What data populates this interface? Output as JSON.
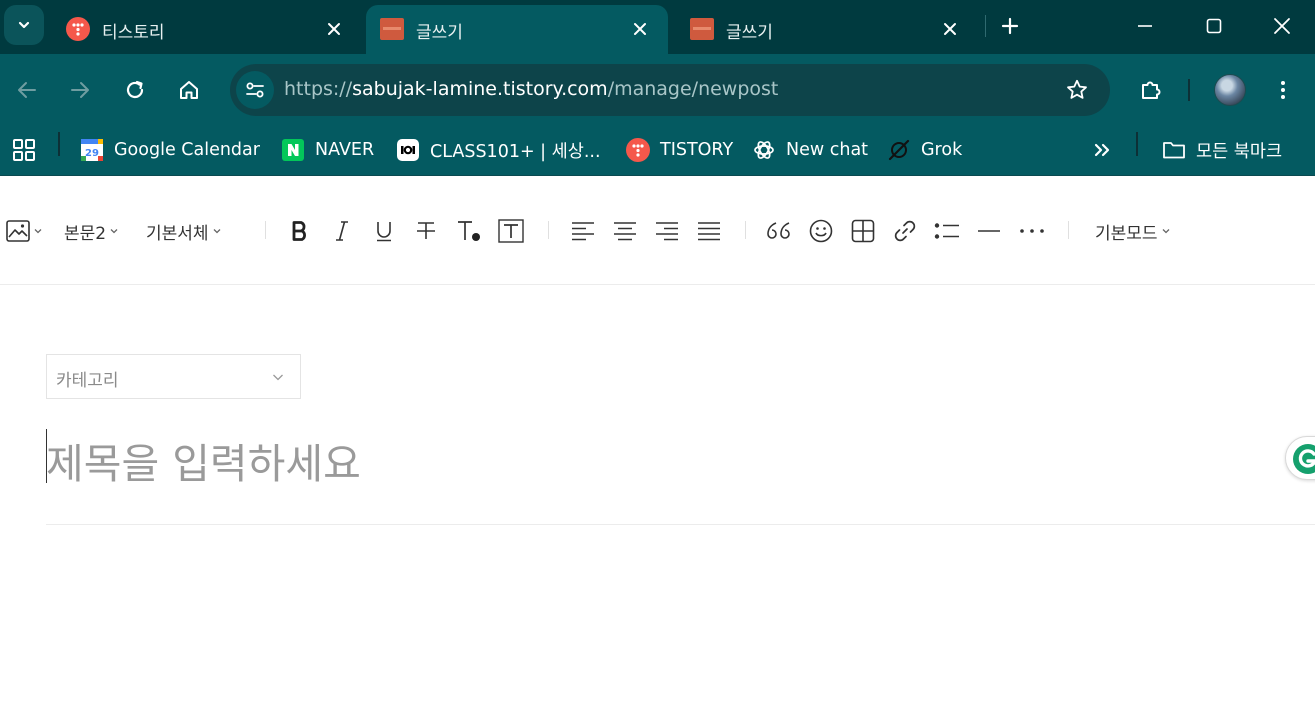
{
  "browser": {
    "tabs": [
      {
        "title": "티스토리",
        "favicon": "tistory-icon",
        "active": false
      },
      {
        "title": "글쓰기",
        "favicon": "tistory-post-icon",
        "active": true
      },
      {
        "title": "글쓰기",
        "favicon": "tistory-post-icon",
        "active": false
      }
    ],
    "url": {
      "scheme": "https://",
      "host": "sabujak-lamine.tistory.com",
      "path": "/manage/newpost"
    },
    "bookmarks": [
      {
        "label": "Google Calendar",
        "icon": "google-calendar-icon"
      },
      {
        "label": "NAVER",
        "icon": "naver-icon"
      },
      {
        "label": "CLASS101+ | 세상...",
        "icon": "class101-icon"
      },
      {
        "label": "TISTORY",
        "icon": "tistory-icon"
      },
      {
        "label": "New chat",
        "icon": "chatgpt-icon"
      },
      {
        "label": "Grok",
        "icon": "grok-icon"
      }
    ],
    "all_bookmarks": "모든 북마크",
    "calendar_day": "29"
  },
  "editor": {
    "toolbar": {
      "paragraph_style": "본문2",
      "font_family": "기본서체",
      "mode": "기본모드"
    },
    "category_placeholder": "카테고리",
    "title_placeholder": "제목을 입력하세요"
  },
  "colors": {
    "tabstrip_bg": "#003a3f",
    "toolbar_bg": "#045a61",
    "tistory_red": "#f5584b",
    "grammarly_green": "#15a06d"
  }
}
